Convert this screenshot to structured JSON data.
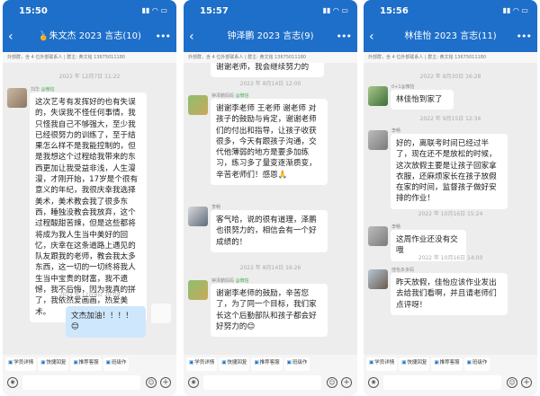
{
  "phones": [
    {
      "time": "15:50",
      "status_icons": "▮▮ ◠ ▭",
      "title": "🏅朱文杰 2023 言志(10)",
      "notice": "外部群，含 4 位外部联系人 | 群主: 黄文铭 13675011180",
      "quick": [
        "学员详情",
        "快捷回复",
        "推荐客服",
        "班级作"
      ],
      "messages": [
        {
          "ts": "2022 年 12月7日 11:22"
        },
        {
          "sender": "刘华",
          "tag": "@微信",
          "text": "这次艺考有发挥好的也有失误的，失误我不怪任何事情，我只怪我自己不够强大，至少我已经很努力的训练了，至于结果怎么样不是我能控制的，但是我想这个过程给我带来的东西更加让我受益非浅，人生漫漫，才刚开始，17岁是个很有意义的年纪，我很庆幸我选择美术，美术教会我了很多东西，睡独没教会我放弃，这个过程酸甜苦辣，但是这些都将将成为我人生当中美好的回忆，庆幸在这条道路上遇见的队友跟我的老师，教会我太多东西，这一切的一切终将我人生当中宝贵的财富，我不遗憾，我不后悔，因为我真的拼了，我依然爱画画，热爱美术。"
        },
        {
          "ts": "2022 年 12月8日 20:09"
        },
        {
          "self": true,
          "text": "文杰加油！！！！😊"
        }
      ]
    },
    {
      "time": "15:57",
      "status_icons": "▮▮ ◠ ▭",
      "title": "钟泽鹏 2023 言志(9)",
      "notice": "外部群，含 4 位外部联系人 | 群主: 黄文铭 13675011180",
      "quick": [
        "学员详情",
        "快捷回复",
        "推荐客服",
        "班级作"
      ],
      "messages": [
        {
          "text": "谢谢老师，我会继续努力的"
        },
        {
          "ts": "2022 年 8月14日 12:00"
        },
        {
          "sender": "钟泽鹏妈妈",
          "tag": "@微信",
          "text": "谢谢李老师 王老师 谢老师 对孩子的鼓励与肯定，谢谢老师们的付出和指导，让孩子收获很多，今天有跟孩子沟通，交代他薄弱的地方是要多加练习，练习多了量变逐渐质变，辛苦老师们！感恩🙏"
        },
        {
          "sender": "李畅",
          "text": "客气哈，说的很有道理，泽鹏也很努力的，相信会有一个好成绩的！"
        },
        {
          "ts": "2022 年 8月14日 16:26"
        },
        {
          "sender": "钟泽鹏妈妈",
          "tag": "@微信",
          "text": "谢谢李老师的鼓励，辛苦您了，为了同一个目标，我们家长这个后勤部队和孩子都会好好努力的😊"
        }
      ]
    },
    {
      "time": "15:56",
      "status_icons": "▮▮ ◠ ▭",
      "title": "林佳怡 2023 言志(11)",
      "notice": "外部群，含 4 位外部联系人 | 群主: 黄文铭 13675011180",
      "quick": [
        "学员详情",
        "快捷回复",
        "推荐客服",
        "班级作"
      ],
      "messages": [
        {
          "ts": "2022 年 8月30日 16:28"
        },
        {
          "sender": "0+1@微信",
          "text": "林佳怡到家了"
        },
        {
          "ts": "2022 年 9月15日 12:34"
        },
        {
          "sender": "李畅",
          "text": "好的，离联考时间已经过半了，现在还不是放松的时候，这次放假主要是让孩子回家拿衣服，还麻烦家长在孩子放假在家的时间，监督孩子做好安排的作业！"
        },
        {
          "ts": "2022 年 10月16日 15:24"
        },
        {
          "sender": "李畅",
          "text": "这周作业还没有交哦"
        },
        {
          "ts": "2022 年 10月16日 14:00"
        },
        {
          "sender": "佳怡多多妈",
          "text": "昨天放假，佳怡应该作业发出去给我们看啊，并且请老师们点评呀！"
        }
      ]
    }
  ]
}
